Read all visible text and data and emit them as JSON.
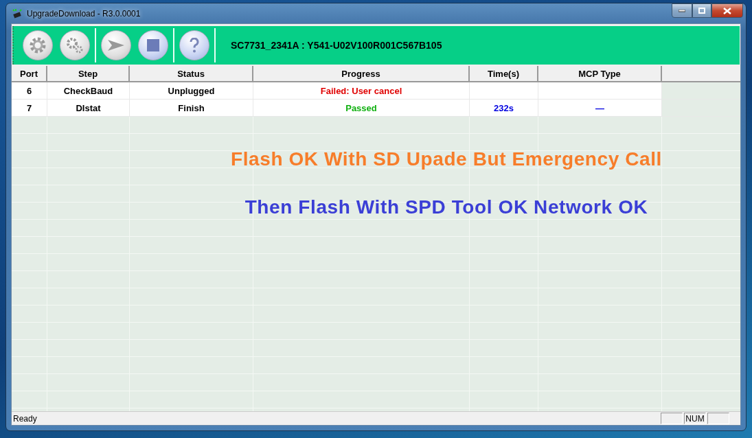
{
  "window": {
    "title": "UpgradeDownload - R3.0.0001"
  },
  "toolbar": {
    "device_info": "SC7731_2341A : Y541-U02V100R001C567B105"
  },
  "table": {
    "columns": [
      "Port",
      "Step",
      "Status",
      "Progress",
      "Time(s)",
      "MCP Type"
    ],
    "rows": [
      {
        "port": "6",
        "step": "CheckBaud",
        "status": "Unplugged",
        "progress": "Failed: User cancel",
        "kind": "failed",
        "time": "",
        "mcp_type": ""
      },
      {
        "port": "7",
        "step": "DIstat",
        "status": "Finish",
        "progress": "Passed",
        "kind": "passed",
        "time": "232s",
        "mcp_type": "—"
      }
    ]
  },
  "captions": [
    {
      "text": "Flash OK With SD Upade But Emergency Call",
      "color": "#f77d2a"
    },
    {
      "text": "Then Flash With SPD Tool OK Network OK",
      "color": "#3b3fd6"
    }
  ],
  "status_bar": {
    "text": "Ready",
    "panes": [
      {
        "kind": "blank"
      },
      {
        "kind": "label",
        "text": "NUM"
      },
      {
        "kind": "blank"
      }
    ]
  }
}
